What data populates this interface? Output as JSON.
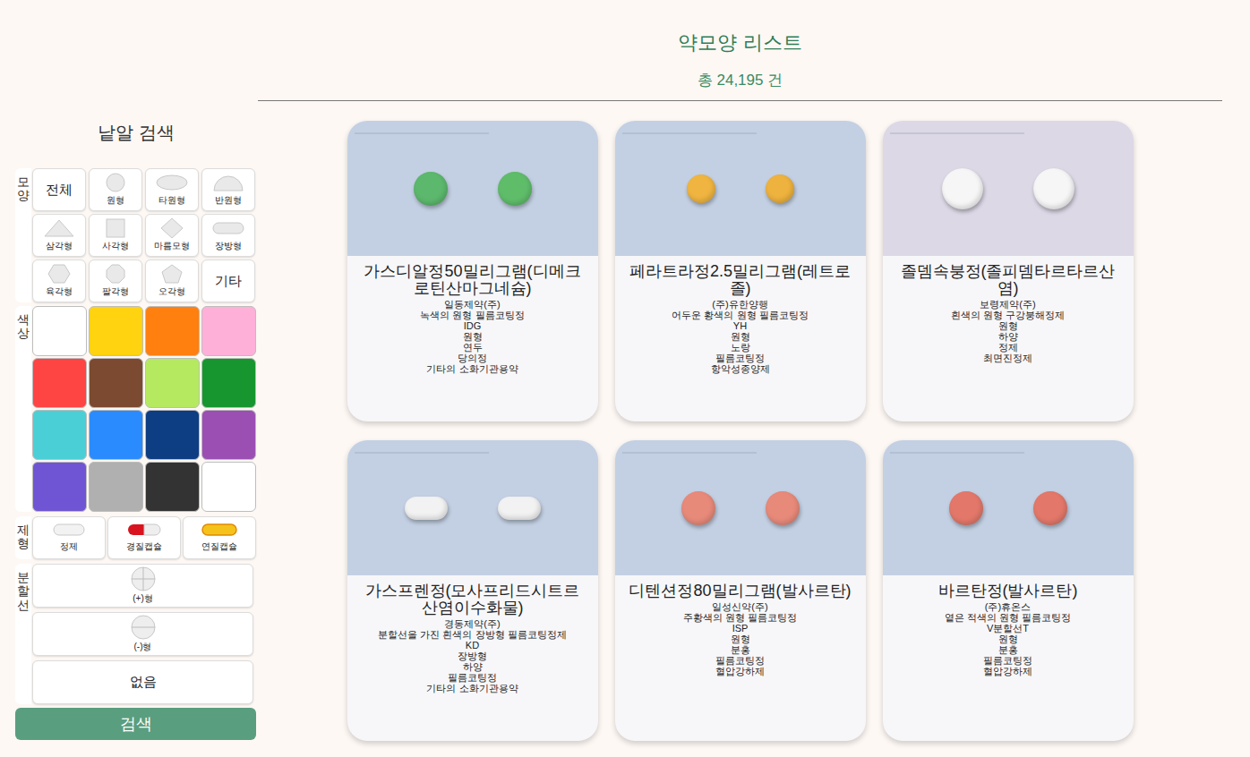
{
  "header": {
    "title": "약모양 리스트",
    "count": "총 24,195 건"
  },
  "sidebar": {
    "title": "낱알 검색",
    "shape_filter": {
      "label": "모양",
      "options": [
        {
          "label": "전체",
          "kind": "none",
          "selected": false
        },
        {
          "label": "원형",
          "kind": "circle",
          "selected": false
        },
        {
          "label": "타원형",
          "kind": "oval",
          "selected": false
        },
        {
          "label": "반원형",
          "kind": "semicircle",
          "selected": false
        },
        {
          "label": "삼각형",
          "kind": "triangle",
          "selected": false
        },
        {
          "label": "사각형",
          "kind": "square",
          "selected": false
        },
        {
          "label": "마름모형",
          "kind": "diamond",
          "selected": false
        },
        {
          "label": "장방형",
          "kind": "oblong",
          "selected": false
        },
        {
          "label": "육각형",
          "kind": "hexagon",
          "selected": false
        },
        {
          "label": "팔각형",
          "kind": "octagon",
          "selected": false
        },
        {
          "label": "오각형",
          "kind": "pentagon",
          "selected": false
        },
        {
          "label": "기타",
          "kind": "none",
          "selected": false
        }
      ]
    },
    "color_filter": {
      "label": "색상",
      "options": [
        {
          "color": "#ffffff",
          "selected": false
        },
        {
          "color": "#ffd30f",
          "selected": false
        },
        {
          "color": "#ff7f0f",
          "selected": false
        },
        {
          "color": "#ffb0d9",
          "selected": false
        },
        {
          "color": "#ff4444",
          "selected": false
        },
        {
          "color": "#7b4a30",
          "selected": false
        },
        {
          "color": "#b5e960",
          "selected": false
        },
        {
          "color": "#17962f",
          "selected": false
        },
        {
          "color": "#4acfd6",
          "selected": false
        },
        {
          "color": "#2a8bff",
          "selected": false
        },
        {
          "color": "#0d3d83",
          "selected": false
        },
        {
          "color": "#9b4fb3",
          "selected": false
        },
        {
          "color": "#6f55d3",
          "selected": false
        },
        {
          "color": "#b0b0b0",
          "selected": false
        },
        {
          "color": "#333333",
          "selected": false
        },
        {
          "color": "#ffffff",
          "selected": false
        }
      ]
    },
    "form_filter": {
      "label": "제형",
      "options": [
        {
          "label": "정제",
          "kind": "tablet",
          "selected": false
        },
        {
          "label": "경질캡슐",
          "kind": "hardcapsule",
          "selected": false
        },
        {
          "label": "연질캡슐",
          "kind": "softcapsule",
          "selected": false
        }
      ]
    },
    "split_filter": {
      "label": "분할선",
      "options": [
        {
          "label": "(+)형",
          "kind": "plus",
          "selected": false
        },
        {
          "label": "(-)형",
          "kind": "minus",
          "selected": false
        },
        {
          "label": "없음",
          "kind": "none",
          "selected": false
        }
      ]
    },
    "search_button": "검색"
  },
  "cards": [
    {
      "name": "가스디알정50밀리그램(디메크로틴산마그네슘)",
      "lines": [
        "일동제약(주)",
        "녹색의 원형 필름코팅정",
        "IDG",
        "원형",
        "연두",
        "당의정",
        "기타의 소화기관용약"
      ],
      "photo_bg": "#c3d0e3",
      "pills": [
        {
          "kind": "round",
          "color": "#5cb86c"
        },
        {
          "kind": "round",
          "color": "#5fbd6a"
        }
      ]
    },
    {
      "name": "페라트라정2.5밀리그램(레트로졸)",
      "lines": [
        "(주)유한양행",
        "어두운 황색의 원형 필름코팅정",
        "YH",
        "원형",
        "노랑",
        "필름코팅정",
        "항악성종양제"
      ],
      "photo_bg": "#c3d0e3",
      "pills": [
        {
          "kind": "small",
          "color": "#f0b540"
        },
        {
          "kind": "small",
          "color": "#eeb23e"
        }
      ]
    },
    {
      "name": "졸뎀속붕정(졸피뎀타르타르산염)",
      "lines": [
        "보령제약(주)",
        "흰색의 원형 구강붕해정제",
        "원형",
        "하양",
        "정제",
        "최면진정제"
      ],
      "photo_bg": "#dcd8e6",
      "pills": [
        {
          "kind": "large",
          "color": "#f6f6f6"
        },
        {
          "kind": "large",
          "color": "#f6f6f6"
        }
      ]
    },
    {
      "name": "가스프렌정(모사프리드시트르산염이수화물)",
      "lines": [
        "경동제약(주)",
        "분할선을 가진 흰색의 장방형 필름코팅정제",
        "KD",
        "장방형",
        "하양",
        "필름코팅정",
        "기타의 소화기관용약"
      ],
      "photo_bg": "#c3d0e3",
      "pills": [
        {
          "kind": "oblong",
          "color": "#f2f2f2"
        },
        {
          "kind": "oblong",
          "color": "#f2f2f2"
        }
      ]
    },
    {
      "name": "디텐션정80밀리그램(발사르탄)",
      "lines": [
        "일성신약(주)",
        "주황색의 원형 필름코팅정",
        "ISP",
        "원형",
        "분홍",
        "필름코팅정",
        "혈압강하제"
      ],
      "photo_bg": "#c3d0e3",
      "pills": [
        {
          "kind": "round",
          "color": "#e88a7a"
        },
        {
          "kind": "round",
          "color": "#e88a7a"
        }
      ]
    },
    {
      "name": "바르탄정(발사르탄)",
      "lines": [
        "(주)휴온스",
        "옅은 적색의 원형 필름코팅정",
        "V분할선T",
        "원형",
        "분홍",
        "필름코팅정",
        "혈압강하제"
      ],
      "photo_bg": "#c3d0e3",
      "pills": [
        {
          "kind": "round",
          "color": "#e3786a"
        },
        {
          "kind": "round",
          "color": "#e3786a"
        }
      ]
    }
  ]
}
